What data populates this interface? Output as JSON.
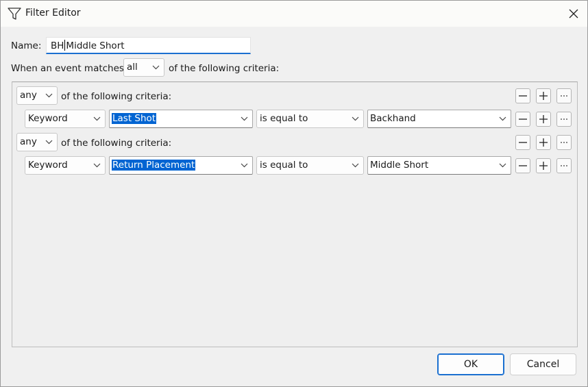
{
  "window": {
    "title": "Filter Editor"
  },
  "name": {
    "label": "Name:",
    "value_before": "BH",
    "value_after": "Middle Short"
  },
  "match": {
    "prefix": "When an event matches",
    "value": "all",
    "suffix": "of the following criteria:"
  },
  "groups": [
    {
      "match": "any",
      "suffix": "of the following criteria:",
      "rule": {
        "type": "Keyword",
        "field": "Last Shot",
        "operator": "is equal to",
        "value": "Backhand"
      }
    },
    {
      "match": "any",
      "suffix": "of the following criteria:",
      "rule": {
        "type": "Keyword",
        "field": "Return Placement",
        "operator": "is equal to",
        "value": "Middle Short"
      }
    }
  ],
  "buttons": {
    "ok": "OK",
    "cancel": "Cancel",
    "more": "···"
  },
  "icons": {
    "title": "funnel-icon",
    "close": "close-icon",
    "remove": "minus-icon",
    "add": "plus-icon",
    "more": "ellipsis-icon",
    "dropdown": "chevron-down-icon"
  },
  "colors": {
    "accent": "#1a6fd0",
    "selection": "#0064d2"
  }
}
